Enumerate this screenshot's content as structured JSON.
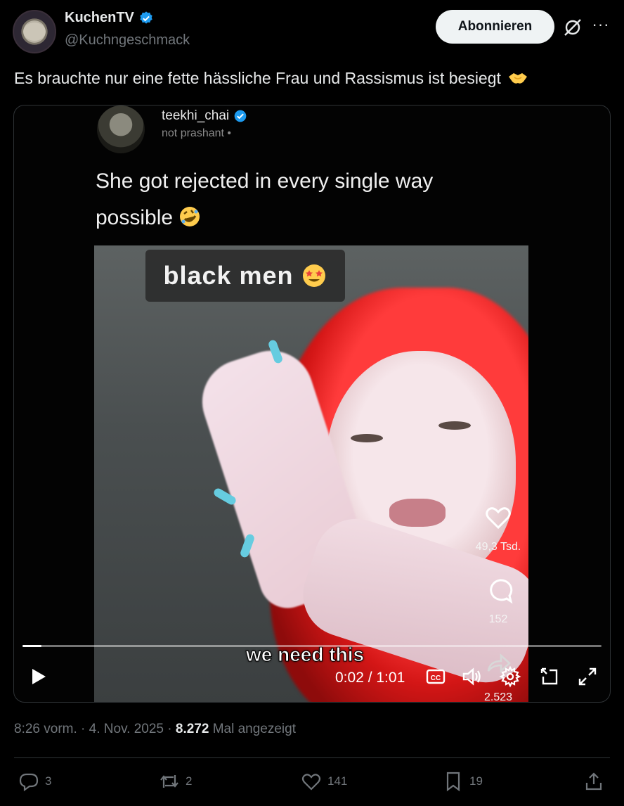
{
  "author": {
    "name": "KuchenTV",
    "handle": "@Kuchngeschmack",
    "follow_label": "Abonnieren"
  },
  "tweet": {
    "text": "Es brauchte nur eine fette hässliche Frau und Rassismus ist besiegt"
  },
  "embedded_post": {
    "username": "teekhi_chai",
    "subline": "not prashant •",
    "text": "She got rejected in every single way possible",
    "video_caption": "black men",
    "subtitle": "we need this",
    "likes": "49,3 Tsd.",
    "comments": "152",
    "shares": "2.523"
  },
  "video": {
    "time": "0:02 / 1:01",
    "progress_fraction": 0.033
  },
  "meta": {
    "time": "8:26 vorm.",
    "date": "4. Nov. 2025",
    "views_count": "8.272",
    "views_label": "Mal angezeigt"
  },
  "actions": {
    "replies": "3",
    "reposts": "2",
    "likes": "141",
    "bookmarks": "19"
  },
  "colors": {
    "verified": "#1d9bf0",
    "muted": "#71767b"
  }
}
